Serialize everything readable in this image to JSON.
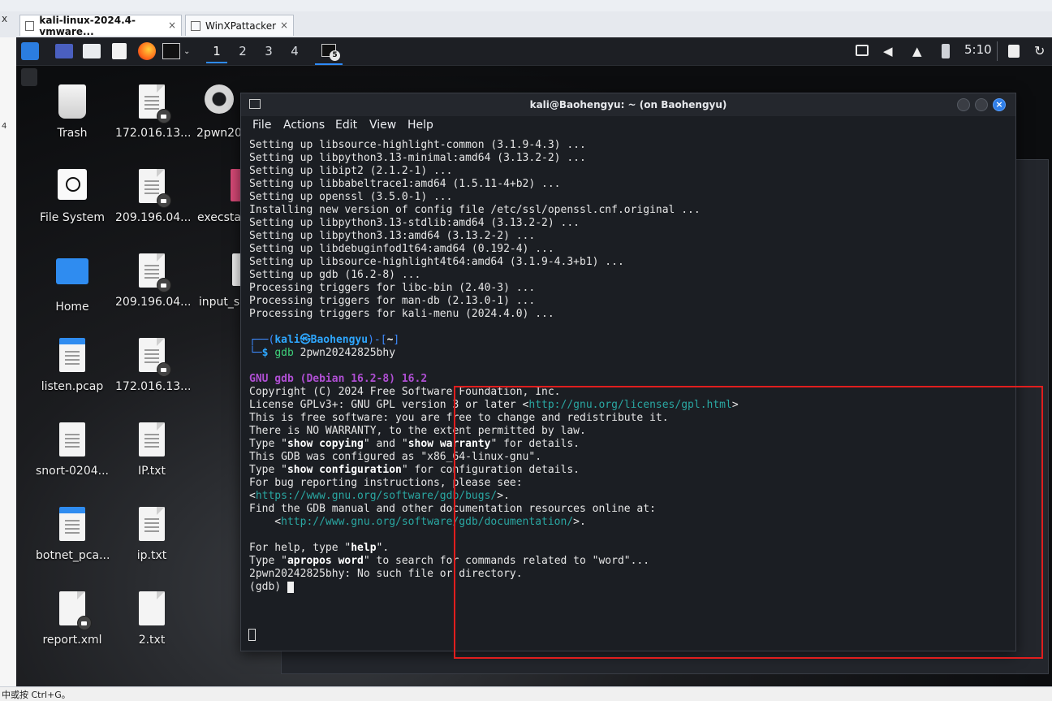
{
  "host": {
    "tabs": [
      {
        "label": "kali-linux-2024.4-vmware...",
        "active": true
      },
      {
        "label": "WinXPattacker",
        "active": false
      }
    ],
    "close_glyph": "×",
    "left_gutter": [
      "x",
      "4"
    ],
    "status_text": "中或按 Ctrl+G。"
  },
  "panel": {
    "workspaces": [
      "1",
      "2",
      "3",
      "4"
    ],
    "active_workspace": "1",
    "terminal_badge": "5",
    "clock": "5:10",
    "accent_color": "#2e8bff"
  },
  "desktop": {
    "icons": [
      {
        "label": "Trash",
        "icon": "trash-icon"
      },
      {
        "label": "172.016.13...",
        "icon": "locked-file-icon"
      },
      {
        "label": "2pwn20",
        "icon": "gear-icon"
      },
      {
        "label": "File System",
        "icon": "drive-icon"
      },
      {
        "label": "209.196.04...",
        "icon": "locked-file-icon"
      },
      {
        "label": "execsta",
        "icon": "file-icon"
      },
      {
        "label": "Home",
        "icon": "home-folder-icon"
      },
      {
        "label": "209.196.04...",
        "icon": "locked-file-icon"
      },
      {
        "label": "input_s",
        "icon": "file-icon"
      },
      {
        "label": "listen.pcap",
        "icon": "binary-file-icon"
      },
      {
        "label": "172.016.13...",
        "icon": "locked-file-icon"
      },
      {
        "label": "snort-0204...",
        "icon": "text-file-icon"
      },
      {
        "label": "IP.txt",
        "icon": "text-file-icon"
      },
      {
        "label": "botnet_pca...",
        "icon": "binary-file-icon"
      },
      {
        "label": "ip.txt",
        "icon": "text-file-icon"
      },
      {
        "label": "report.xml",
        "icon": "xml-file-icon"
      },
      {
        "label": "2.txt",
        "icon": "text-file-icon"
      }
    ]
  },
  "terminal": {
    "title": "kali@Baohengyu: ~ (on Baohengyu)",
    "menu": [
      "File",
      "Actions",
      "Edit",
      "View",
      "Help"
    ],
    "close_glyph": "×",
    "lines": [
      "Setting up libsource-highlight-common (3.1.9-4.3) ...",
      "Setting up libpython3.13-minimal:amd64 (3.13.2-2) ...",
      "Setting up libipt2 (2.1.2-1) ...",
      "Setting up libbabeltrace1:amd64 (1.5.11-4+b2) ...",
      "Setting up openssl (3.5.0-1) ...",
      "Installing new version of config file /etc/ssl/openssl.cnf.original ...",
      "Setting up libpython3.13-stdlib:amd64 (3.13.2-2) ...",
      "Setting up libpython3.13:amd64 (3.13.2-2) ...",
      "Setting up libdebuginfod1t64:amd64 (0.192-4) ...",
      "Setting up libsource-highlight4t64:amd64 (3.1.9-4.3+b1) ...",
      "Setting up gdb (16.2-8) ...",
      "Processing triggers for libc-bin (2.40-3) ...",
      "Processing triggers for man-db (2.13.0-1) ...",
      "Processing triggers for kali-menu (2024.4.0) ..."
    ],
    "prompt_user": "kali",
    "prompt_at": "㉿",
    "prompt_host": "Baohengyu",
    "prompt_dir": "~",
    "prompt_prefix": "┌──(",
    "prompt_mid": ")-[",
    "prompt_suffix": "]",
    "prompt_line2_prefix": "└─",
    "prompt_symbol": "$",
    "command": "gdb",
    "command_arg": "2pwn20242825bhy",
    "gdb_banner": "GNU gdb (Debian 16.2-8) 16.2",
    "gdb_lines": [
      "Copyright (C) 2024 Free Software Foundation, Inc.",
      "License GPLv3+: GNU GPL version 3 or later <",
      "http://gnu.org/licenses/gpl.html",
      ">",
      "This is free software: you are free to change and redistribute it.",
      "There is NO WARRANTY, to the extent permitted by law.",
      "Type \"",
      "show copying",
      "\" and \"",
      "show warranty",
      "\" for details.",
      "This GDB was configured as \"x86_64-linux-gnu\".",
      "Type \"",
      "show configuration",
      "\" for configuration details.",
      "For bug reporting instructions, please see:",
      "<",
      "https://www.gnu.org/software/gdb/bugs/",
      ">.",
      "Find the GDB manual and other documentation resources online at:",
      "    <",
      "http://www.gnu.org/software/gdb/documentation/",
      ">.",
      "For help, type \"",
      "help",
      "\".",
      "Type \"",
      "apropos word",
      "\" to search for commands related to \"word\"...",
      "2pwn20242825bhy: No such file or directory.",
      "(gdb) "
    ]
  },
  "annotation": {
    "highlight_color": "#e01e1e"
  }
}
